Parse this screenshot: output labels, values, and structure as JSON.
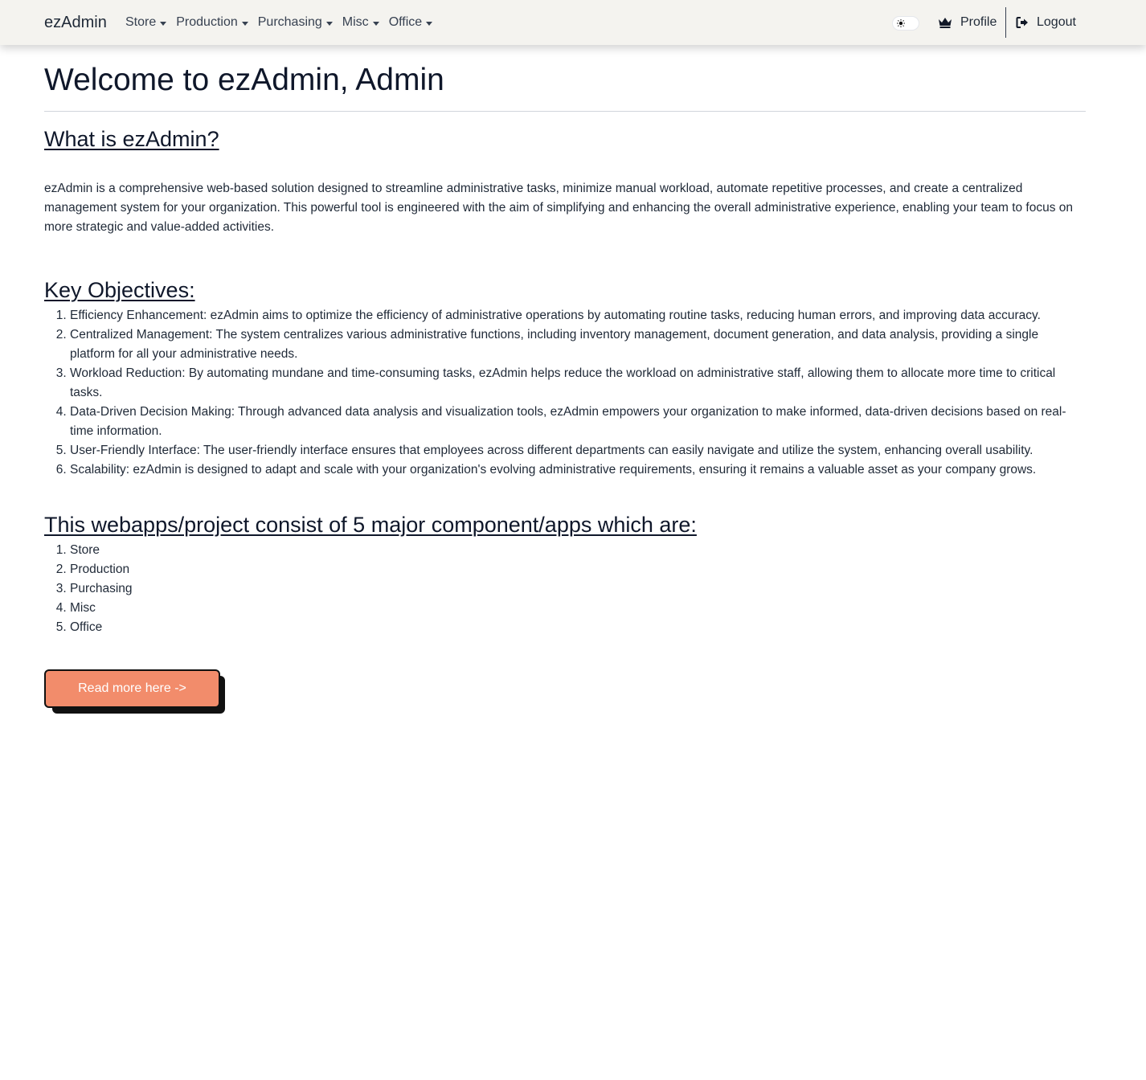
{
  "navbar": {
    "brand": "ezAdmin",
    "menu": [
      {
        "label": "Store"
      },
      {
        "label": "Production"
      },
      {
        "label": "Purchasing"
      },
      {
        "label": "Misc"
      },
      {
        "label": "Office"
      }
    ],
    "theme_toggle_icon": "sun-icon",
    "profile": {
      "label": "Profile",
      "icon": "crown-icon"
    },
    "logout": {
      "label": "Logout",
      "icon": "sign-out-icon"
    }
  },
  "main": {
    "title": "Welcome to ezAdmin, Admin",
    "what_heading": "What is ezAdmin?",
    "what_paragraph": "ezAdmin is a comprehensive web-based solution designed to streamline administrative tasks, minimize manual workload, automate repetitive processes, and create a centralized management system for your organization. This powerful tool is engineered with the aim of simplifying and enhancing the overall administrative experience, enabling your team to focus on more strategic and value-added activities.",
    "objectives_heading": "Key Objectives:",
    "objectives": [
      "Efficiency Enhancement: ezAdmin aims to optimize the efficiency of administrative operations by automating routine tasks, reducing human errors, and improving data accuracy.",
      "Centralized Management: The system centralizes various administrative functions, including inventory management, document generation, and data analysis, providing a single platform for all your administrative needs.",
      "Workload Reduction: By automating mundane and time-consuming tasks, ezAdmin helps reduce the workload on administrative staff, allowing them to allocate more time to critical tasks.",
      "Data-Driven Decision Making: Through advanced data analysis and visualization tools, ezAdmin empowers your organization to make informed, data-driven decisions based on real-time information.",
      "User-Friendly Interface: The user-friendly interface ensures that employees across different departments can easily navigate and utilize the system, enhancing overall usability.",
      "Scalability: ezAdmin is designed to adapt and scale with your organization's evolving administrative requirements, ensuring it remains a valuable asset as your company grows."
    ],
    "apps_heading": "This webapps/project consist of 5 major component/apps which are:",
    "apps": [
      "Store",
      "Production",
      "Purchasing",
      "Misc",
      "Office"
    ],
    "read_more_label": "Read more here ->"
  },
  "colors": {
    "navbar_bg": "#f4f3ef",
    "button_bg": "#f28c6b",
    "button_shadow": "#111111",
    "heading_text": "#0f172a"
  }
}
